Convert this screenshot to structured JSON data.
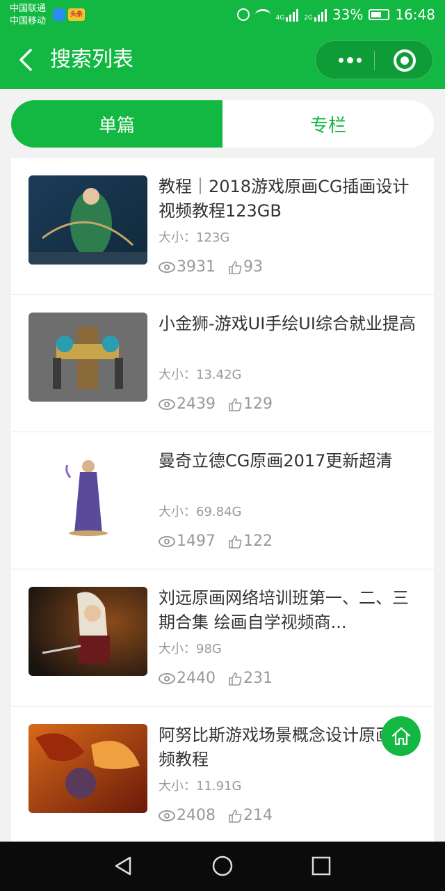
{
  "status_bar": {
    "carrier_1": "中国联通",
    "carrier_2": "中国移动",
    "app_badge": "头条",
    "net_1": "4G",
    "net_2": "2G",
    "battery": "33%",
    "time": "16:48"
  },
  "nav": {
    "title": "搜索列表"
  },
  "tabs": [
    {
      "label": "单篇",
      "active": true
    },
    {
      "label": "专栏",
      "active": false
    }
  ],
  "items": [
    {
      "title": "教程｜2018游戏原画CG插画设计视频教程123GB",
      "size": "大小：123G",
      "views": "3931",
      "likes": "93"
    },
    {
      "title": "小金狮-游戏UI手绘UI综合就业提高",
      "size": "大小：13.42G",
      "views": "2439",
      "likes": "129"
    },
    {
      "title": "曼奇立德CG原画2017更新超清",
      "size": "大小：69.84G",
      "views": "1497",
      "likes": "122"
    },
    {
      "title": "刘远原画网络培训班第一、二、三期合集 绘画自学视频商...",
      "size": "大小：98G",
      "views": "2440",
      "likes": "231"
    },
    {
      "title": "阿努比斯游戏场景概念设计原画视频教程",
      "size": "大小：11.91G",
      "views": "2408",
      "likes": "214"
    }
  ],
  "colors": {
    "brand_green": "#12b841"
  }
}
